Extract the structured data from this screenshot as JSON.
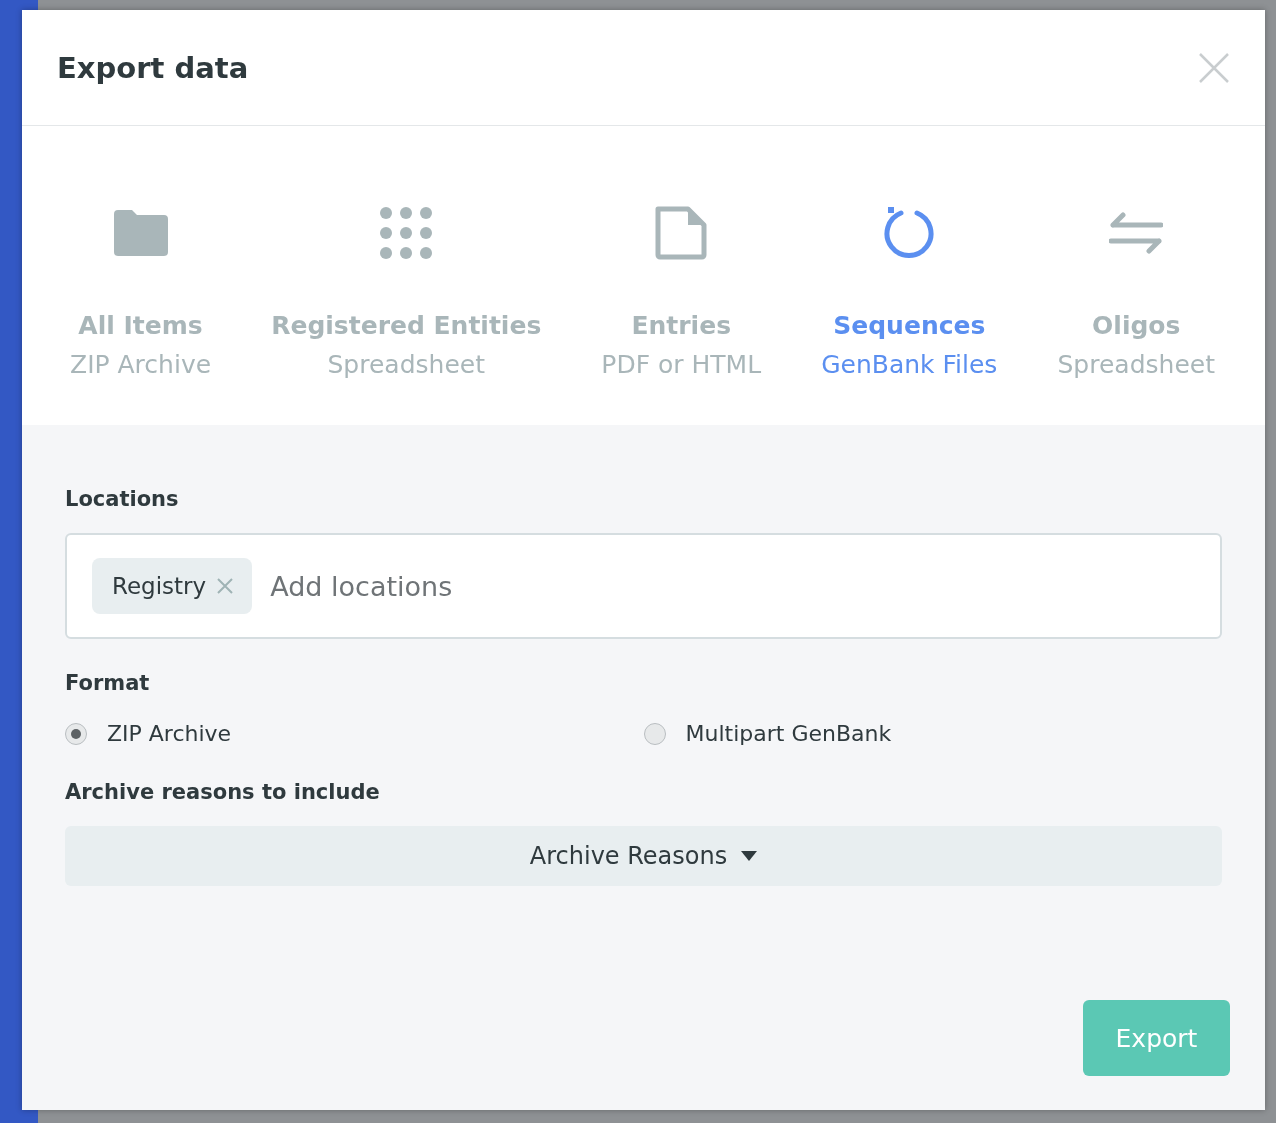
{
  "dialog": {
    "title": "Export data"
  },
  "export_types": [
    {
      "kind": "folder",
      "label": "All Items",
      "sublabel": "ZIP Archive",
      "selected": false
    },
    {
      "kind": "grid",
      "label": "Registered Entities",
      "sublabel": "Spreadsheet",
      "selected": false
    },
    {
      "kind": "document",
      "label": "Entries",
      "sublabel": "PDF or HTML",
      "selected": false
    },
    {
      "kind": "sequence",
      "label": "Sequences",
      "sublabel": "GenBank Files",
      "selected": true
    },
    {
      "kind": "arrows",
      "label": "Oligos",
      "sublabel": "Spreadsheet",
      "selected": false
    }
  ],
  "locations": {
    "label": "Locations",
    "tags": [
      {
        "label": "Registry"
      }
    ],
    "placeholder": "Add locations"
  },
  "format": {
    "label": "Format",
    "options": [
      {
        "label": "ZIP Archive",
        "selected": true
      },
      {
        "label": "Multipart GenBank",
        "selected": false
      }
    ]
  },
  "archive_reasons": {
    "label": "Archive reasons to include",
    "dropdown": "Archive Reasons"
  },
  "export_button": "Export"
}
